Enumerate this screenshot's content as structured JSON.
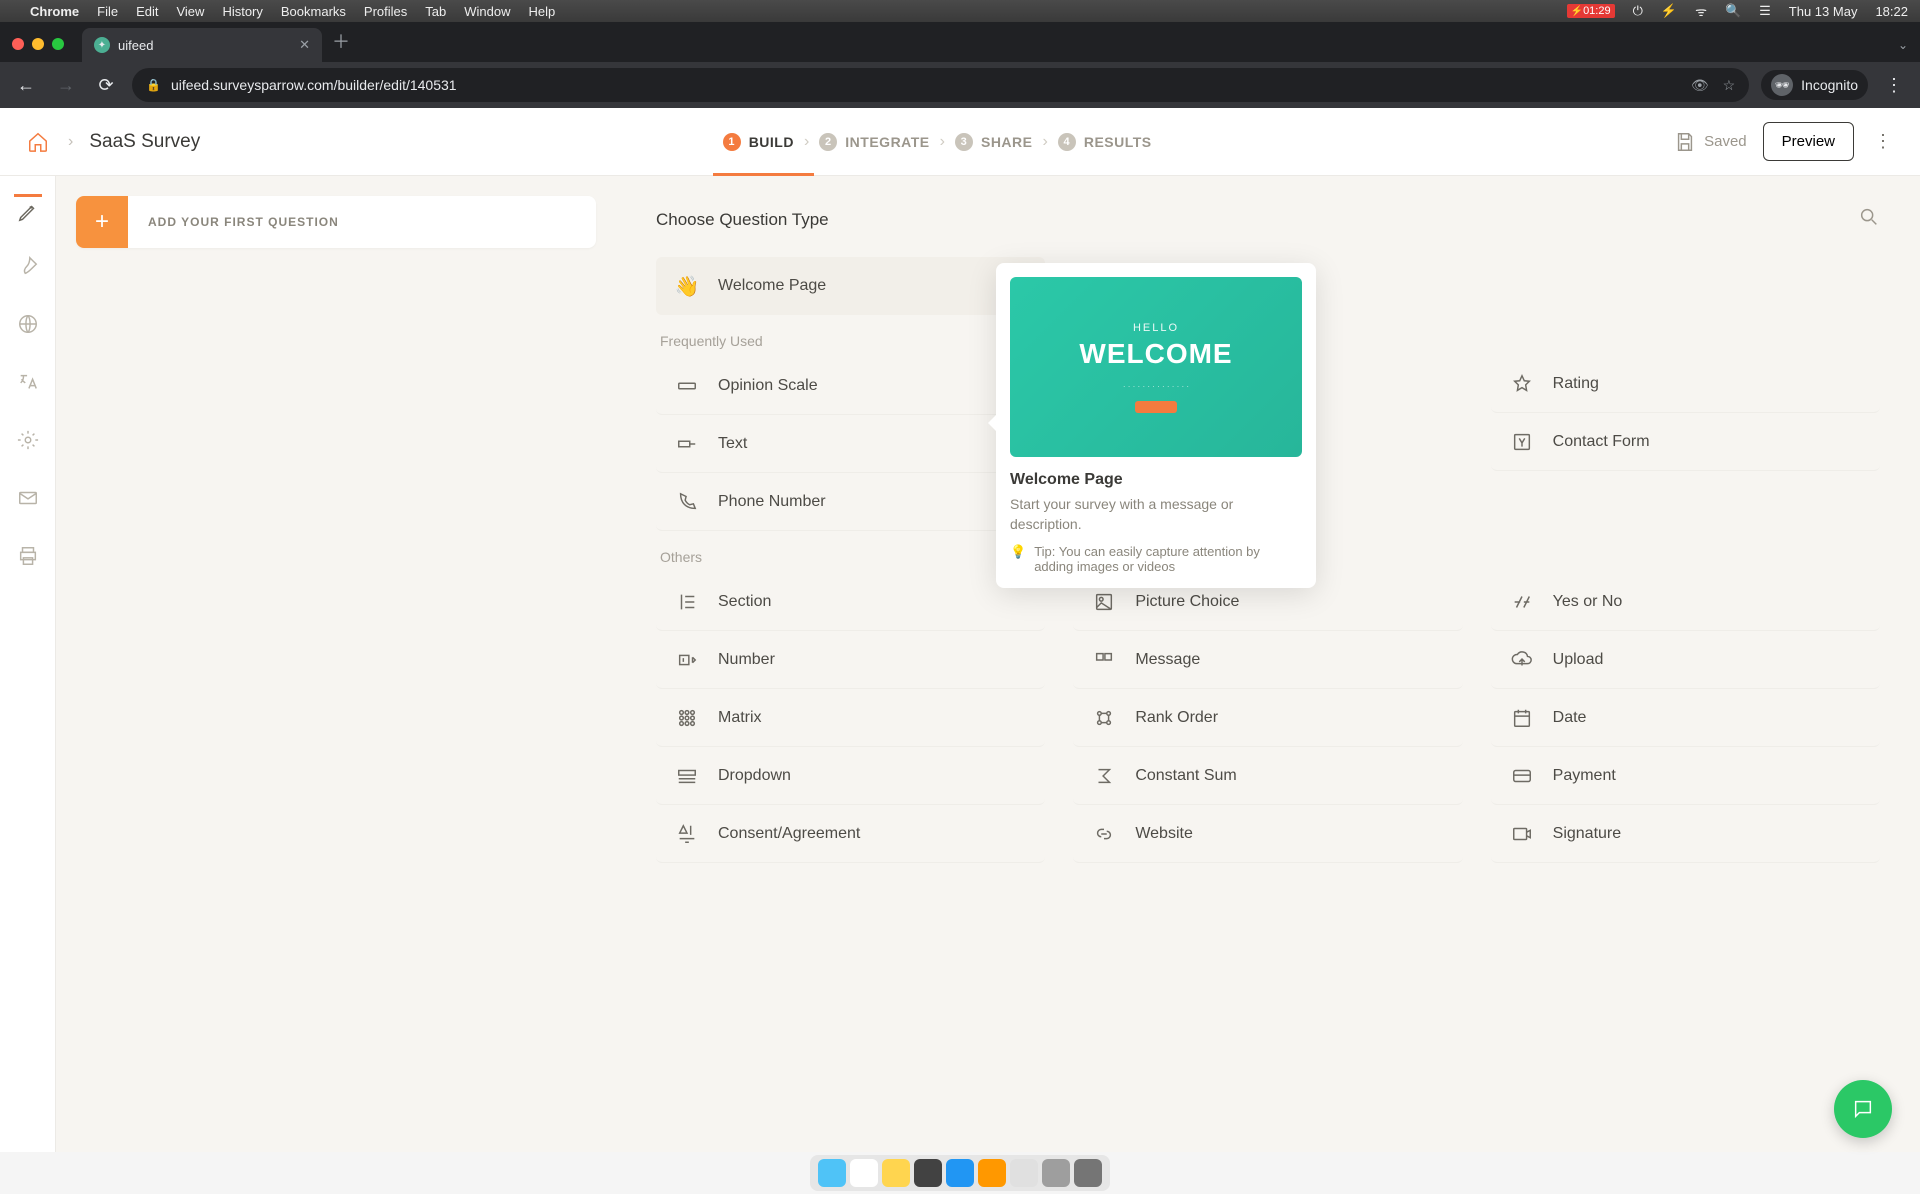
{
  "menubar": {
    "app": "Chrome",
    "items": [
      "File",
      "Edit",
      "View",
      "History",
      "Bookmarks",
      "Profiles",
      "Tab",
      "Window",
      "Help"
    ],
    "battery": "01:29",
    "date": "Thu 13 May",
    "time": "18:22"
  },
  "browser": {
    "tab_title": "uifeed",
    "url": "uifeed.surveysparrow.com/builder/edit/140531",
    "incognito_label": "Incognito"
  },
  "header": {
    "survey_title": "SaaS Survey",
    "steps": [
      {
        "num": "1",
        "label": "BUILD",
        "active": true
      },
      {
        "num": "2",
        "label": "INTEGRATE",
        "active": false
      },
      {
        "num": "3",
        "label": "SHARE",
        "active": false
      },
      {
        "num": "4",
        "label": "RESULTS",
        "active": false
      }
    ],
    "saved_label": "Saved",
    "preview_label": "Preview"
  },
  "sidebar": {
    "add_first": "ADD YOUR FIRST QUESTION"
  },
  "picker": {
    "title": "Choose Question Type",
    "welcome": "Welcome Page",
    "freq_label": "Frequently Used",
    "freq_col1": [
      "Opinion Scale",
      "Text",
      "Phone Number"
    ],
    "freq_col3": [
      "Rating",
      "Contact Form"
    ],
    "others_label": "Others",
    "others": [
      [
        "Section",
        "Picture Choice",
        "Yes or No"
      ],
      [
        "Number",
        "Message",
        "Upload"
      ],
      [
        "Matrix",
        "Rank Order",
        "Date"
      ],
      [
        "Dropdown",
        "Constant Sum",
        "Payment"
      ],
      [
        "Consent/Agreement",
        "Website",
        "Signature"
      ]
    ]
  },
  "popover": {
    "hello": "HELLO",
    "welcome": "WELCOME",
    "title": "Welcome Page",
    "desc": "Start your survey with a message or description.",
    "tip": "Tip: You can easily capture attention by adding images or videos"
  }
}
